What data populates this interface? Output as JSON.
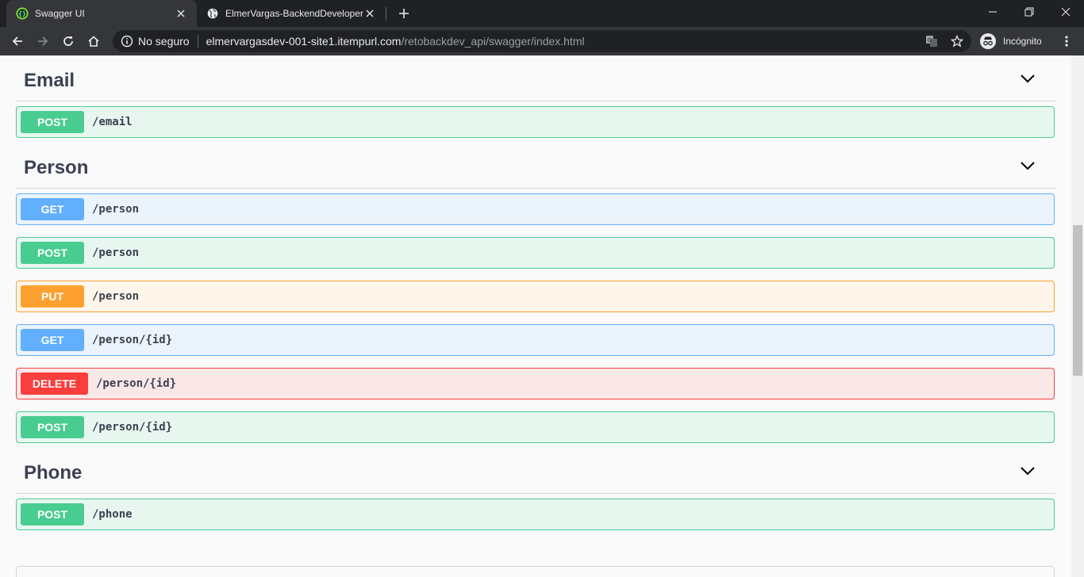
{
  "browser": {
    "tabs": [
      {
        "title": "Swagger UI",
        "active": true,
        "icon": "swagger-icon"
      },
      {
        "title": "ElmerVargas-BackendDeveloper",
        "active": false,
        "icon": "globe-icon"
      }
    ],
    "address": {
      "security_label": "No seguro",
      "host": "elmervargasdev-001-site1.itempurl.com",
      "path": "/retobackdev_api/swagger/index.html"
    },
    "profile_label": "Incógnito"
  },
  "colors": {
    "post": "#49cc90",
    "get": "#61affe",
    "put": "#fca130",
    "delete": "#f93e3e",
    "heading": "#3b4151"
  },
  "sections": [
    {
      "name": "Email",
      "operations": [
        {
          "method": "POST",
          "path": "/email"
        }
      ]
    },
    {
      "name": "Person",
      "operations": [
        {
          "method": "GET",
          "path": "/person"
        },
        {
          "method": "POST",
          "path": "/person"
        },
        {
          "method": "PUT",
          "path": "/person"
        },
        {
          "method": "GET",
          "path": "/person/{id}"
        },
        {
          "method": "DELETE",
          "path": "/person/{id}"
        },
        {
          "method": "POST",
          "path": "/person/{id}"
        }
      ]
    },
    {
      "name": "Phone",
      "operations": [
        {
          "method": "POST",
          "path": "/phone"
        }
      ]
    }
  ]
}
